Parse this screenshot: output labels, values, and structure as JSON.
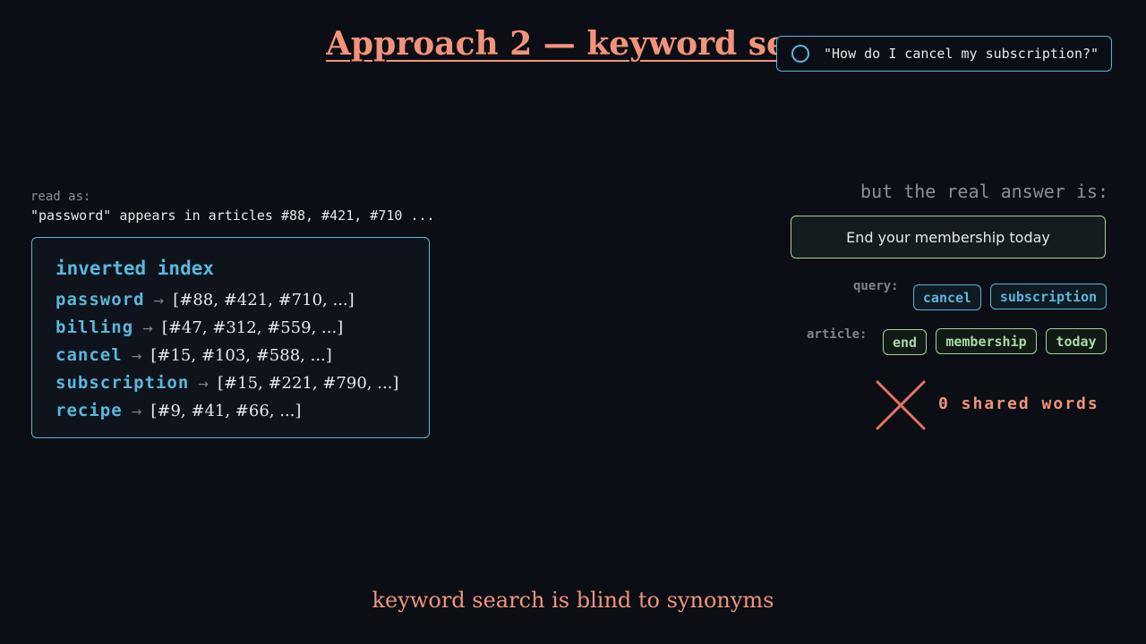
{
  "title": "Approach 2 — keyword search",
  "query": {
    "text": "\"How do I cancel my subscription?\"",
    "icon": "circle-icon"
  },
  "read_as": {
    "label": "read as:",
    "line": "\"password\" appears in articles #88, #421, #710 ..."
  },
  "index": {
    "title": "inverted index",
    "arrow": "→",
    "rows": [
      {
        "term": "password",
        "postings": "[#88, #421, #710, ...]"
      },
      {
        "term": "billing",
        "postings": "[#47, #312, #559, ...]"
      },
      {
        "term": "cancel",
        "postings": "[#15, #103, #588, ...]"
      },
      {
        "term": "subscription",
        "postings": "[#15, #221, #790, ...]"
      },
      {
        "term": "recipe",
        "postings": "[#9, #41, #66, ...]"
      }
    ]
  },
  "answer": {
    "label": "but the real answer is:",
    "text": "End your membership today"
  },
  "comparison": {
    "query_label": "query:",
    "query_words": [
      "cancel",
      "subscription"
    ],
    "article_label": "article:",
    "article_words": [
      "end",
      "membership",
      "today"
    ],
    "result": "0 shared words",
    "result_icon": "cross-icon"
  },
  "caption": "keyword search is blind to synonyms",
  "colors": {
    "background": "#0b0e14",
    "accent_salmon": "#f2937a",
    "accent_blue": "#5ab7dc",
    "accent_green": "#9ed49a",
    "muted": "#8a8f98"
  }
}
